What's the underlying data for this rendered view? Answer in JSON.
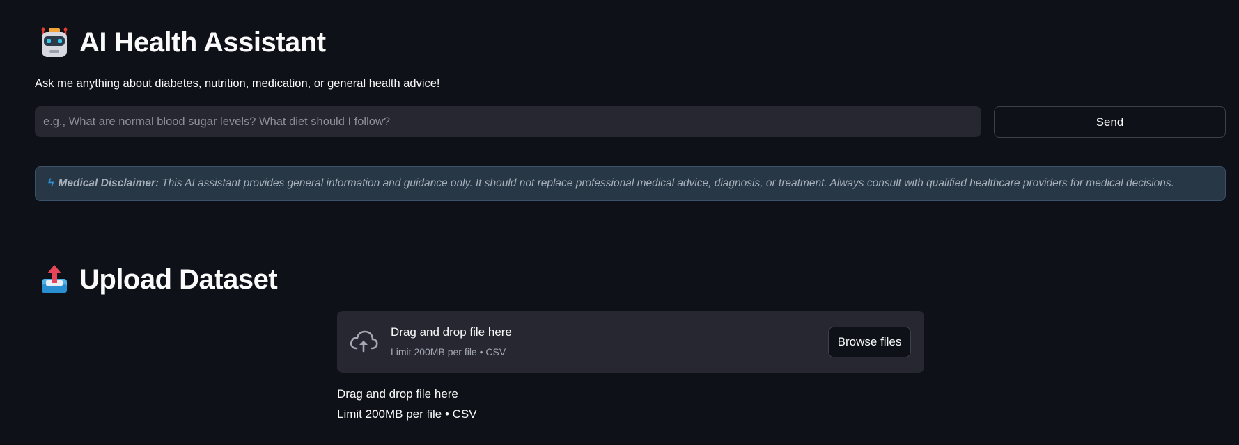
{
  "header": {
    "emoji_icon": "robot-face-icon",
    "title": "AI Health Assistant",
    "subtitle": "Ask me anything about diabetes, nutrition, medication, or general health advice!"
  },
  "chat": {
    "input_value": "",
    "input_placeholder": "e.g., What are normal blood sugar levels? What diet should I follow?",
    "send_label": "Send"
  },
  "disclaimer": {
    "icon": "lightning-bolt-icon",
    "label": "Medical Disclaimer:",
    "text": "This AI assistant provides general information and guidance only. It should not replace professional medical advice, diagnosis, or treatment. Always consult with qualified healthcare providers for medical decisions."
  },
  "upload": {
    "emoji_icon": "outbox-tray-icon",
    "title": "Upload Dataset",
    "dropzone_icon": "cloud-upload-icon",
    "dropzone_title": "Drag and drop file here",
    "dropzone_subtitle": "Limit 200MB per file • CSV",
    "browse_label": "Browse files",
    "fallback_title": "Drag and drop file here",
    "fallback_subtitle": "Limit 200MB per file • CSV"
  },
  "colors": {
    "background": "#0e1117",
    "input_bg": "#262730",
    "disclaimer_bg": "#273746",
    "accent_blue": "#2f8fd7"
  }
}
